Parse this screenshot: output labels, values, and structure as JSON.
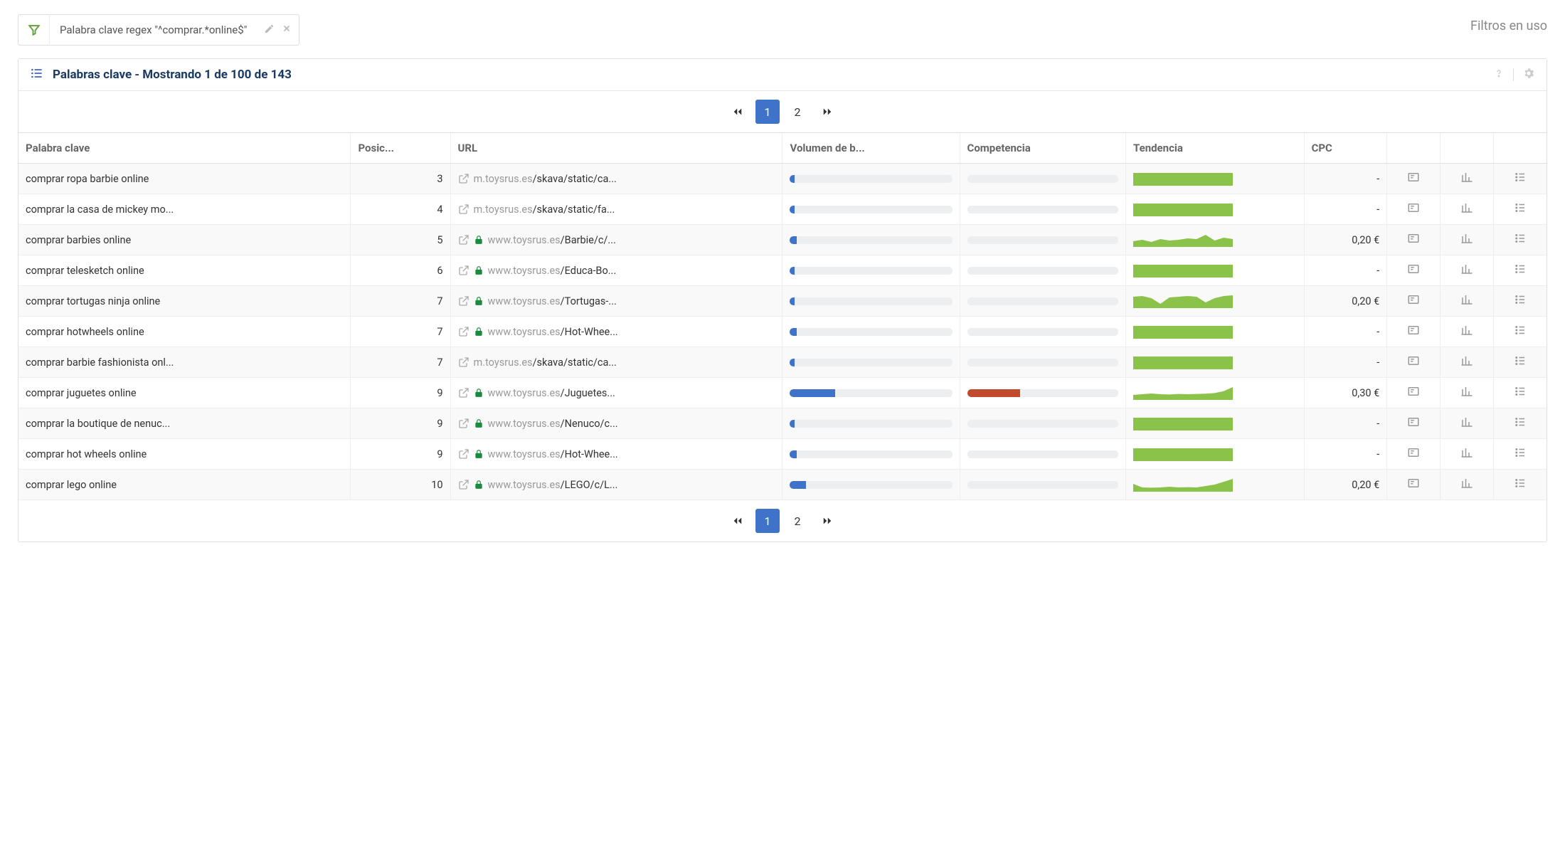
{
  "filters_in_use_label": "Filtros en uso",
  "filter_chip": {
    "label": "Palabra clave regex \"^comprar.*online$\""
  },
  "panel": {
    "title": "Palabras clave - Mostrando 1 de 100 de 143"
  },
  "pagination": {
    "pages": [
      "1",
      "2"
    ],
    "active": "1"
  },
  "columns": {
    "keyword": "Palabra clave",
    "position": "Posic...",
    "url": "URL",
    "volume": "Volumen de b...",
    "competition": "Competencia",
    "trend": "Tendencia",
    "cpc": "CPC"
  },
  "rows": [
    {
      "keyword": "comprar ropa barbie online",
      "position": "3",
      "url_lock": false,
      "url_domain": "m.toysrus.es",
      "url_path": "/skava/static/ca...",
      "volume_pct": 3,
      "competition_pct": 0,
      "trend": [
        90,
        90,
        90,
        90,
        90,
        90,
        90,
        90,
        90,
        90,
        90,
        90
      ],
      "cpc": "-"
    },
    {
      "keyword": "comprar la casa de mickey mo...",
      "position": "4",
      "url_lock": false,
      "url_domain": "m.toysrus.es",
      "url_path": "/skava/static/fa...",
      "volume_pct": 3,
      "competition_pct": 0,
      "trend": [
        90,
        90,
        90,
        90,
        90,
        90,
        90,
        90,
        90,
        90,
        90,
        90
      ],
      "cpc": "-"
    },
    {
      "keyword": "comprar barbies online",
      "position": "5",
      "url_lock": true,
      "url_domain": "www.toysrus.es",
      "url_path": "/Barbie/c/...",
      "volume_pct": 4,
      "competition_pct": 0,
      "trend": [
        40,
        50,
        35,
        55,
        45,
        50,
        60,
        55,
        85,
        45,
        65,
        55
      ],
      "cpc": "0,20 €"
    },
    {
      "keyword": "comprar telesketch online",
      "position": "6",
      "url_lock": true,
      "url_domain": "www.toysrus.es",
      "url_path": "/Educa-Bo...",
      "volume_pct": 3,
      "competition_pct": 0,
      "trend": [
        90,
        90,
        90,
        90,
        90,
        90,
        90,
        90,
        90,
        90,
        90,
        90
      ],
      "cpc": "-"
    },
    {
      "keyword": "comprar tortugas ninja online",
      "position": "7",
      "url_lock": true,
      "url_domain": "www.toysrus.es",
      "url_path": "/Tortugas-...",
      "volume_pct": 3,
      "competition_pct": 0,
      "trend": [
        80,
        85,
        70,
        30,
        75,
        80,
        85,
        80,
        40,
        70,
        85,
        90
      ],
      "cpc": "0,20 €"
    },
    {
      "keyword": "comprar hotwheels online",
      "position": "7",
      "url_lock": true,
      "url_domain": "www.toysrus.es",
      "url_path": "/Hot-Whee...",
      "volume_pct": 4,
      "competition_pct": 0,
      "trend": [
        90,
        90,
        90,
        90,
        90,
        90,
        90,
        90,
        90,
        90,
        90,
        90
      ],
      "cpc": "-"
    },
    {
      "keyword": "comprar barbie fashionista onl...",
      "position": "7",
      "url_lock": false,
      "url_domain": "m.toysrus.es",
      "url_path": "/skava/static/ca...",
      "volume_pct": 3,
      "competition_pct": 0,
      "trend": [
        90,
        90,
        90,
        90,
        90,
        90,
        90,
        90,
        90,
        90,
        90,
        90
      ],
      "cpc": "-"
    },
    {
      "keyword": "comprar juguetes online",
      "position": "9",
      "url_lock": true,
      "url_domain": "www.toysrus.es",
      "url_path": "/Juguetes...",
      "volume_pct": 28,
      "competition_pct": 35,
      "trend": [
        35,
        40,
        45,
        40,
        38,
        42,
        40,
        42,
        44,
        48,
        62,
        90
      ],
      "cpc": "0,30 €"
    },
    {
      "keyword": "comprar la boutique de nenuc...",
      "position": "9",
      "url_lock": true,
      "url_domain": "www.toysrus.es",
      "url_path": "/Nenuco/c...",
      "volume_pct": 3,
      "competition_pct": 0,
      "trend": [
        90,
        90,
        90,
        90,
        90,
        90,
        90,
        90,
        90,
        90,
        90,
        90
      ],
      "cpc": "-"
    },
    {
      "keyword": "comprar hot wheels online",
      "position": "9",
      "url_lock": true,
      "url_domain": "www.toysrus.es",
      "url_path": "/Hot-Whee...",
      "volume_pct": 4,
      "competition_pct": 0,
      "trend": [
        90,
        90,
        90,
        90,
        90,
        90,
        90,
        90,
        90,
        90,
        90,
        90
      ],
      "cpc": "-"
    },
    {
      "keyword": "comprar lego online",
      "position": "10",
      "url_lock": true,
      "url_domain": "www.toysrus.es",
      "url_path": "/LEGO/c/L...",
      "volume_pct": 10,
      "competition_pct": 0,
      "trend": [
        55,
        30,
        28,
        30,
        35,
        30,
        32,
        30,
        40,
        50,
        70,
        90
      ],
      "cpc": "0,20 €"
    }
  ]
}
